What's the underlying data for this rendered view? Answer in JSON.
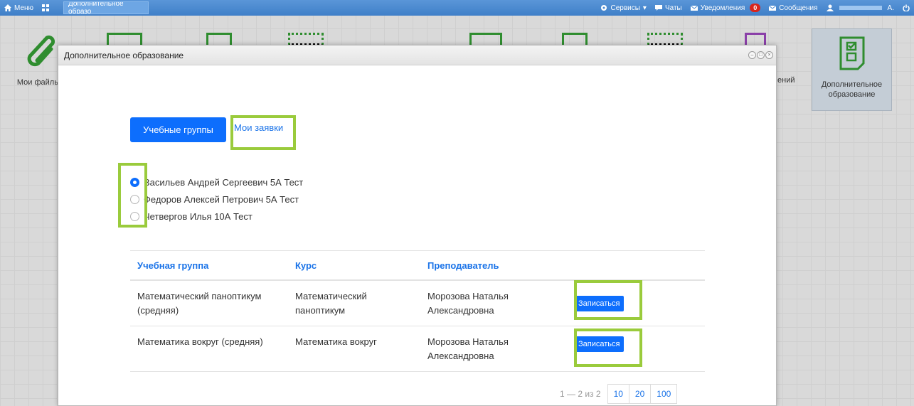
{
  "topbar": {
    "menu_label": "Меню",
    "tab_label": "Дополнительное образо",
    "services_label": "Сервисы",
    "chats_label": "Чаты",
    "notifications_label": "Уведомления",
    "notifications_count": "0",
    "messages_label": "Сообщения",
    "user_initial": "А."
  },
  "desktop": {
    "files_label": "Мои файлы",
    "partial_label": "ений",
    "edu_label_line1": "Дополнительное",
    "edu_label_line2": "образование"
  },
  "modal": {
    "title": "Дополнительное образование",
    "tabs": {
      "groups_label": "Учебные группы",
      "requests_label": "Мои заявки"
    },
    "students": [
      {
        "name": "Васильев Андрей Сергеевич 5А Тест",
        "selected": true
      },
      {
        "name": "Федоров Алексей Петрович 5А Тест",
        "selected": false
      },
      {
        "name": "Четвергов Илья 10А Тест",
        "selected": false
      }
    ],
    "table": {
      "headers": [
        "Учебная группа",
        "Курс",
        "Преподаватель"
      ],
      "rows": [
        {
          "group_line1": "Математический паноптикум",
          "group_line2": "(средняя)",
          "course_line1": "Математический",
          "course_line2": "паноптикум",
          "teacher_line1": "Морозова Наталья",
          "teacher_line2": "Александровна",
          "action": "Записаться"
        },
        {
          "group_line1": "Математика вокруг (средняя)",
          "group_line2": "",
          "course_line1": "Математика вокруг",
          "course_line2": "",
          "teacher_line1": "Морозова Наталья",
          "teacher_line2": "Александровна",
          "action": "Записаться"
        }
      ]
    },
    "pager": {
      "info": "1 — 2 из 2",
      "sizes": [
        "10",
        "20",
        "100"
      ]
    }
  },
  "colors": {
    "primary": "#0d6efd",
    "highlight": "#9acb3c",
    "topbar": "#4a8ad2"
  }
}
